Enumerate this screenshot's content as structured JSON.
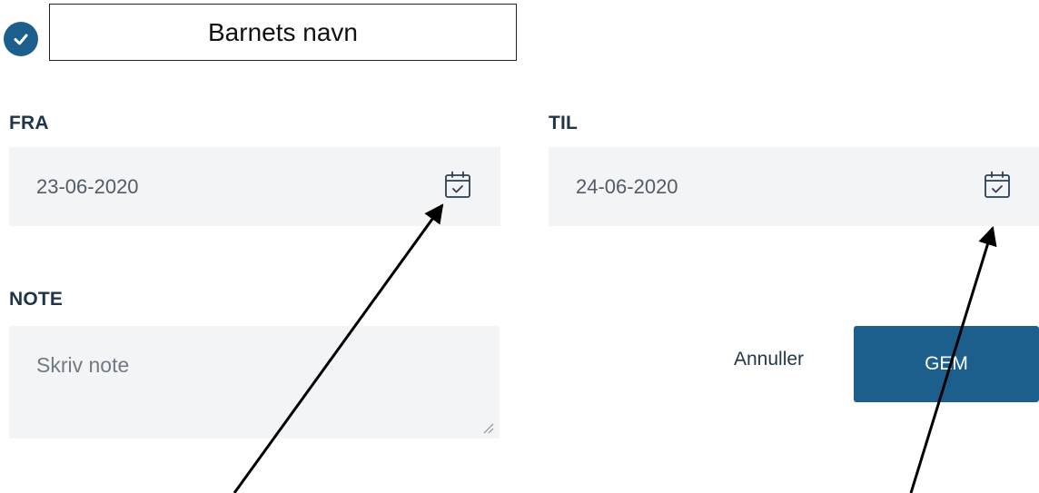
{
  "child_name_box": {
    "text": "Barnets navn"
  },
  "from": {
    "label": "FRA",
    "value": "23-06-2020"
  },
  "to": {
    "label": "TIL",
    "value": "24-06-2020"
  },
  "note": {
    "label": "NOTE",
    "placeholder": "Skriv note"
  },
  "actions": {
    "cancel_label": "Annuller",
    "save_label": "GEM"
  },
  "icons": {
    "status": "check-circle-icon",
    "date_picker": "calendar-check-icon"
  },
  "colors": {
    "accent": "#1c5f8c",
    "field_bg": "#f3f4f6",
    "label": "#1f3549"
  }
}
